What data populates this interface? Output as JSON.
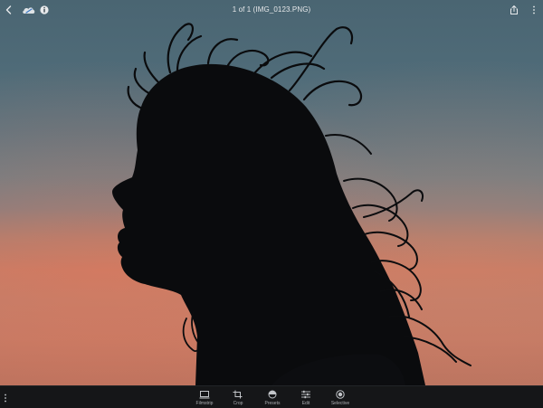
{
  "header": {
    "title": "1 of 1 (IMG_0123.PNG)",
    "back_icon": "chevron-left-icon",
    "cloud_icon": "cloud-sync-icon",
    "info_icon": "info-icon",
    "share_icon": "share-icon",
    "more_icon": "more-vertical-icon"
  },
  "photo": {
    "subject": "silhouette"
  },
  "toolbar": {
    "menu_icon": "more-vertical-icon",
    "tools": [
      {
        "label": "Filmstrip",
        "icon": "filmstrip-icon"
      },
      {
        "label": "Crop",
        "icon": "crop-icon"
      },
      {
        "label": "Presets",
        "icon": "presets-icon"
      },
      {
        "label": "Edit",
        "icon": "sliders-icon"
      },
      {
        "label": "Selective",
        "icon": "selective-icon"
      }
    ]
  },
  "colors": {
    "sky_top": "#4a6572",
    "sunset": "#c27c67",
    "bar_bg": "#151618",
    "icon_light": "#e8eaec"
  }
}
